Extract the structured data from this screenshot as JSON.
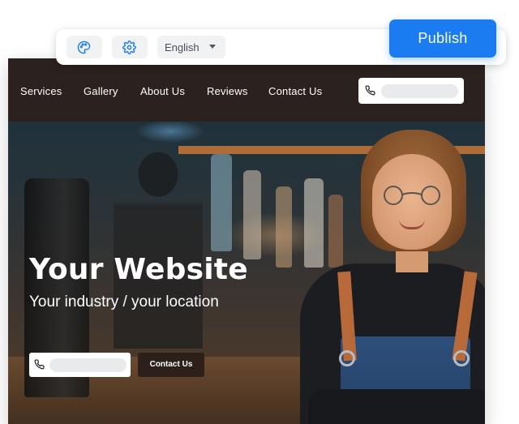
{
  "editor": {
    "toolbar": {
      "theme_icon": "palette-icon",
      "settings_icon": "gear-icon",
      "language": {
        "selected": "English"
      }
    },
    "publish_label": "Publish",
    "accent_color": "#1a7cf0"
  },
  "site": {
    "nav": {
      "items": [
        {
          "label": "Services"
        },
        {
          "label": "Gallery"
        },
        {
          "label": "About Us"
        },
        {
          "label": "Reviews"
        },
        {
          "label": "Contact Us"
        }
      ],
      "phone_icon": "phone-icon"
    },
    "hero": {
      "title": "Your Website",
      "subtitle": "Your industry / your location",
      "contact_button": "Contact Us",
      "phone_icon": "phone-icon"
    },
    "colors": {
      "nav_background": "#2b211e",
      "button_background": "#2d201b"
    }
  }
}
